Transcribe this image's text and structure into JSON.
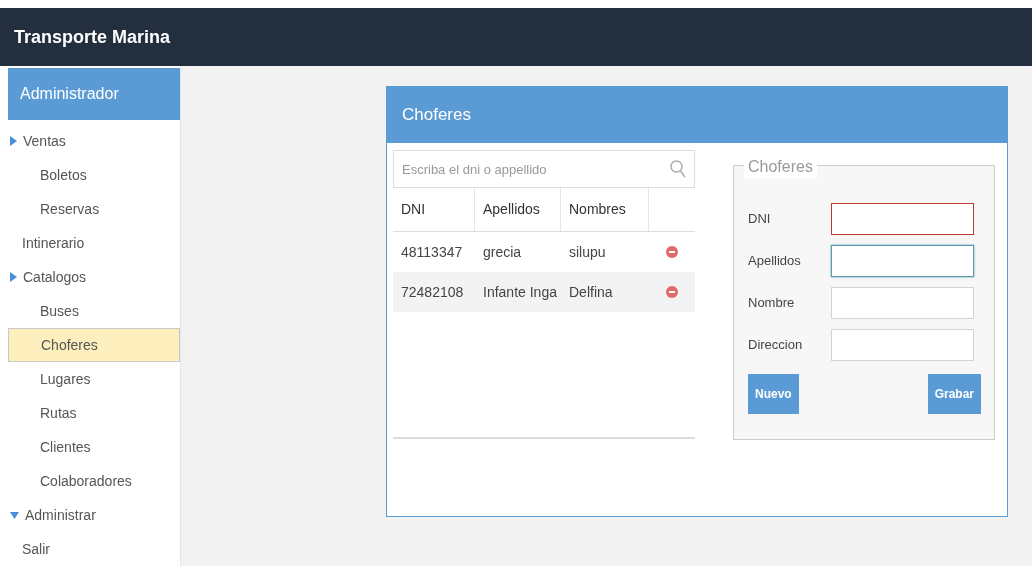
{
  "app": {
    "title": "Transporte Marina"
  },
  "sidebar": {
    "title": "Administrador",
    "items": [
      {
        "label": "Ventas",
        "kind": "group",
        "expanded": false,
        "children": [
          {
            "label": "Boletos",
            "selected": false
          },
          {
            "label": "Reservas",
            "selected": false
          }
        ]
      },
      {
        "label": "Intinerario",
        "kind": "link",
        "selected": false
      },
      {
        "label": "Catalogos",
        "kind": "group",
        "expanded": false,
        "children": [
          {
            "label": "Buses",
            "selected": false
          },
          {
            "label": "Choferes",
            "selected": true
          },
          {
            "label": "Lugares",
            "selected": false
          },
          {
            "label": "Rutas",
            "selected": false
          },
          {
            "label": "Clientes",
            "selected": false
          },
          {
            "label": "Colaboradores",
            "selected": false
          }
        ]
      },
      {
        "label": "Administrar",
        "kind": "group",
        "expanded": true
      },
      {
        "label": "Salir",
        "kind": "link",
        "selected": false
      }
    ]
  },
  "panel": {
    "title": "Choferes",
    "search": {
      "placeholder": "Escriba el dni o appellido"
    },
    "table": {
      "columns": [
        "DNI",
        "Apellidos",
        "Nombres"
      ],
      "rows": [
        {
          "cells": [
            "48113347",
            "grecia",
            "silupu"
          ]
        },
        {
          "cells": [
            "72482108",
            "Infante Inga",
            "Delfina"
          ]
        }
      ]
    },
    "form": {
      "legend": "Choferes",
      "fields": [
        {
          "label": "DNI",
          "invalid": true,
          "focused": false
        },
        {
          "label": "Apellidos",
          "invalid": false,
          "focused": true
        },
        {
          "label": "Nombre",
          "invalid": false,
          "focused": false
        },
        {
          "label": "Direccion",
          "invalid": false,
          "focused": false
        }
      ],
      "buttons": [
        "Nuevo",
        "Grabar"
      ]
    }
  }
}
